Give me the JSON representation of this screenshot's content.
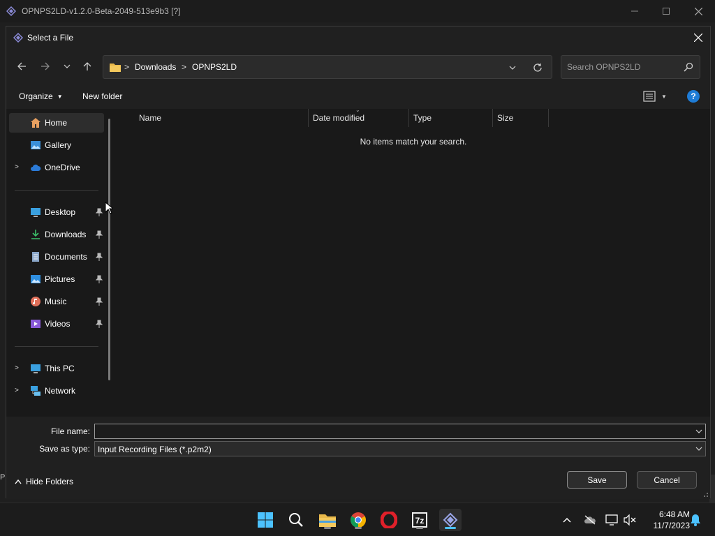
{
  "app": {
    "title": "OPNPS2LD-v1.2.0-Beta-2049-513e9b3 [?]",
    "status_left": "P"
  },
  "dialog": {
    "title": "Select a File",
    "address": {
      "crumbs": [
        "Downloads",
        "OPNPS2LD"
      ],
      "separator": ">"
    },
    "search": {
      "placeholder": "Search OPNPS2LD",
      "value": ""
    },
    "commands": {
      "organize": "Organize",
      "new_folder": "New folder"
    },
    "help_label": "?",
    "nav": {
      "quick": [
        {
          "label": "Home",
          "icon": "home-icon",
          "selected": true,
          "expandable": false
        },
        {
          "label": "Gallery",
          "icon": "gallery-icon",
          "selected": false,
          "expandable": false
        },
        {
          "label": "OneDrive",
          "icon": "cloud-icon",
          "selected": false,
          "expandable": true
        }
      ],
      "pinned": [
        {
          "label": "Desktop",
          "icon": "desktop-icon"
        },
        {
          "label": "Downloads",
          "icon": "download-icon"
        },
        {
          "label": "Documents",
          "icon": "document-icon"
        },
        {
          "label": "Pictures",
          "icon": "pictures-icon"
        },
        {
          "label": "Music",
          "icon": "music-icon"
        },
        {
          "label": "Videos",
          "icon": "videos-icon"
        }
      ],
      "system": [
        {
          "label": "This PC",
          "icon": "computer-icon"
        },
        {
          "label": "Network",
          "icon": "network-icon"
        }
      ]
    },
    "columns": [
      "Name",
      "Date modified",
      "Type",
      "Size"
    ],
    "empty_message": "No items match your search.",
    "file_name": {
      "label": "File name:",
      "value": ""
    },
    "save_type": {
      "label": "Save as type:",
      "value": "Input Recording Files (*.p2m2)"
    },
    "hide_folders": "Hide Folders",
    "buttons": {
      "save": "Save",
      "cancel": "Cancel"
    }
  },
  "taskbar": {
    "apps": [
      "start-icon",
      "search-icon",
      "file-explorer-icon",
      "chrome-icon",
      "opera-icon",
      "7zip-icon",
      "opnps2ld-icon"
    ],
    "seven_zip_label": "7z",
    "time": "6:48 AM",
    "date": "11/7/2023"
  },
  "colors": {
    "accent": "#1e7cd6",
    "taskbar_active": "#4cc2ff",
    "folder": "#e8b84a"
  }
}
